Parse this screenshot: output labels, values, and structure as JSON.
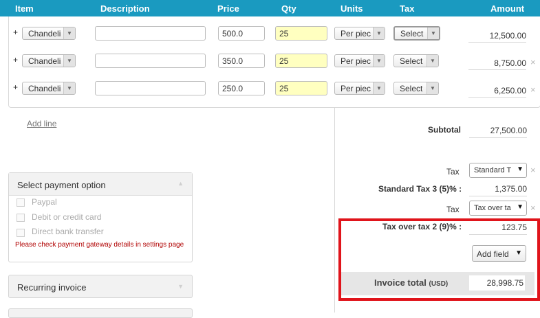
{
  "header": {
    "col_item": "Item",
    "col_description": "Description",
    "col_price": "Price",
    "col_qty": "Qty",
    "col_units": "Units",
    "col_tax": "Tax",
    "col_amount": "Amount"
  },
  "rows": [
    {
      "plus": "+",
      "item": "Chandeli",
      "description": "",
      "price": "500.0",
      "qty": "25",
      "units": "Per piec",
      "tax": "Select",
      "amount": "12,500.00",
      "remove": ""
    },
    {
      "plus": "+",
      "item": "Chandeli",
      "description": "",
      "price": "350.0",
      "qty": "25",
      "units": "Per piec",
      "tax": "Select",
      "amount": "8,750.00",
      "remove": "×"
    },
    {
      "plus": "+",
      "item": "Chandeli",
      "description": "",
      "price": "250.0",
      "qty": "25",
      "units": "Per piec",
      "tax": "Select",
      "amount": "6,250.00",
      "remove": "×"
    }
  ],
  "add_line": "Add line",
  "payment": {
    "title": "Select payment option",
    "options": [
      "Paypal",
      "Debit or credit card",
      "Direct bank transfer"
    ],
    "warning": "Please check payment gateway details in settings page"
  },
  "recurring": {
    "title": "Recurring invoice"
  },
  "summary": {
    "subtotal_label": "Subtotal",
    "subtotal_value": "27,500.00",
    "tax1_label": "Tax",
    "tax1_select": "Standard T",
    "tax1_line_label": "Standard Tax 3 (5)% :",
    "tax1_line_value": "1,375.00",
    "tax2_label": "Tax",
    "tax2_select": "Tax over ta",
    "tax2_line_label": "Tax over tax 2 (9)% :",
    "tax2_line_value": "123.75",
    "add_field": "Add field",
    "total_label": "Invoice total",
    "total_currency": "(USD)",
    "total_value": "28,998.75"
  },
  "icons": {
    "dropdown": "triangle-down-icon",
    "remove": "close-icon",
    "collapse": "triangle-up-icon"
  },
  "colors": {
    "header_bg": "#1a9ac0",
    "qty_bg": "#ffffc0",
    "highlight_border": "#e0141b",
    "warning_text": "#b00000"
  }
}
